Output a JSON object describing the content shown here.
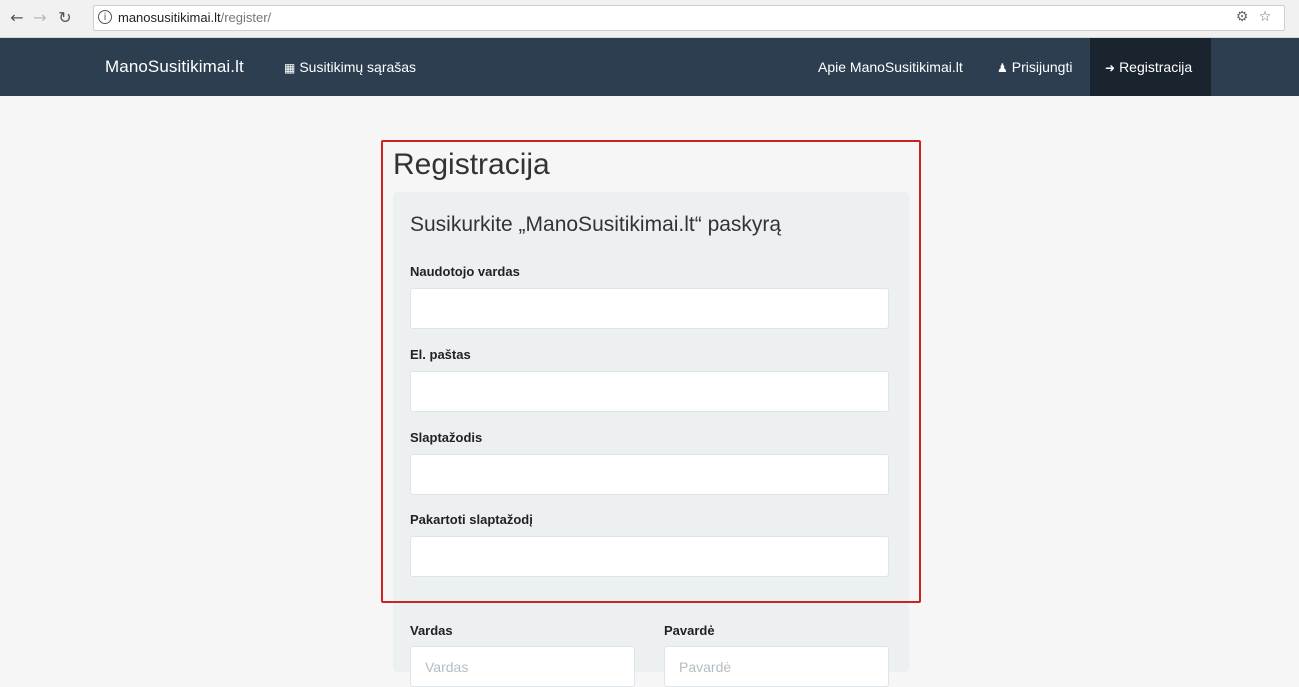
{
  "browser": {
    "url_host": "manosusitikimai.lt",
    "url_path": "/register/"
  },
  "navbar": {
    "brand": "ManoSusitikimai.lt",
    "meetings_link": "Susitikimų sąrašas",
    "about_link": "Apie ManoSusitikimai.lt",
    "login_link": "Prisijungti",
    "register_link": "Registracija"
  },
  "page": {
    "title": "Registracija",
    "form_title": "Susikurkite „ManoSusitikimai.lt“ paskyrą"
  },
  "form": {
    "username_label": "Naudotojo vardas",
    "email_label": "El. paštas",
    "password_label": "Slaptažodis",
    "password_repeat_label": "Pakartoti slaptažodį",
    "first_name_label": "Vardas",
    "first_name_placeholder": "Vardas",
    "last_name_label": "Pavardė",
    "last_name_placeholder": "Pavardė"
  },
  "colors": {
    "navbar": "#2c3e50",
    "navbar_active": "#1a242f",
    "highlight": "#cc2222",
    "well": "#ecf0f1"
  }
}
